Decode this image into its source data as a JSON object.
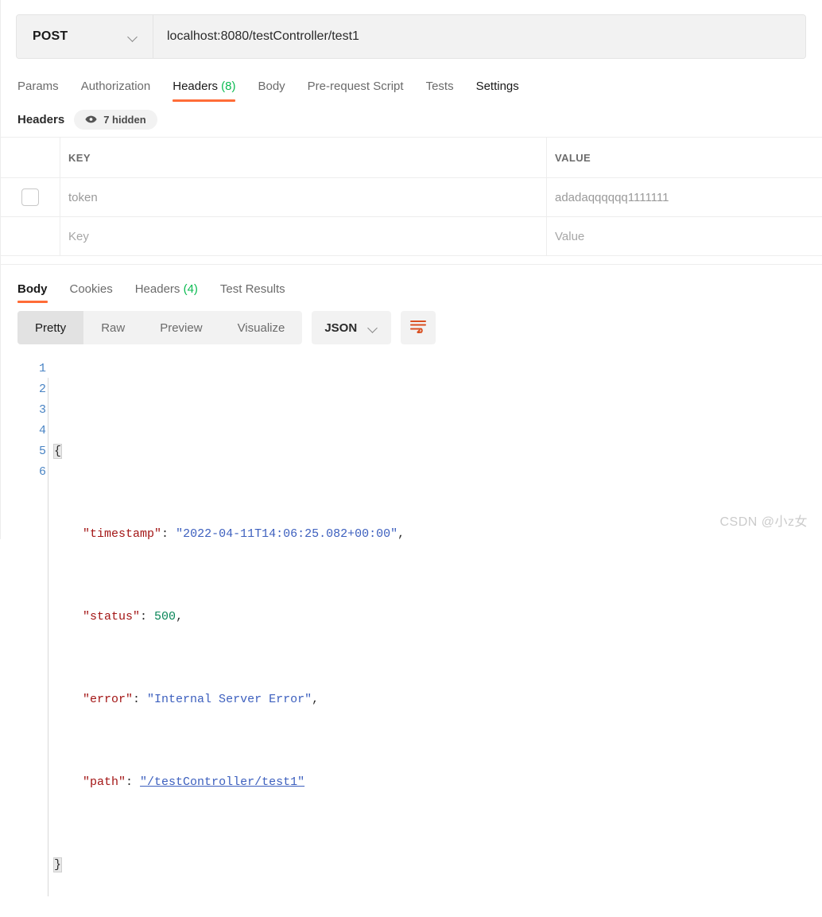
{
  "request": {
    "method": "POST",
    "url": "localhost:8080/testController/test1",
    "method_dropdown_icon": "chevron-down-icon",
    "tabs": [
      {
        "label": "Params",
        "count": "",
        "active": false,
        "bold": false
      },
      {
        "label": "Authorization",
        "count": "",
        "active": false,
        "bold": false
      },
      {
        "label": "Headers",
        "count": "(8)",
        "active": true,
        "bold": false
      },
      {
        "label": "Body",
        "count": "",
        "active": false,
        "bold": false
      },
      {
        "label": "Pre-request Script",
        "count": "",
        "active": false,
        "bold": false
      },
      {
        "label": "Tests",
        "count": "",
        "active": false,
        "bold": false
      },
      {
        "label": "Settings",
        "count": "",
        "active": false,
        "bold": true
      }
    ]
  },
  "headers_section": {
    "title": "Headers",
    "hidden_badge": {
      "icon": "eye-icon",
      "label": "7 hidden"
    },
    "columns": {
      "key": "KEY",
      "value": "VALUE"
    },
    "rows": [
      {
        "checkbox": true,
        "key": "token",
        "value": "adadaqqqqqq1111111",
        "placeholder_row": false
      },
      {
        "checkbox": false,
        "key": "Key",
        "value": "Value",
        "placeholder_row": true
      }
    ]
  },
  "response": {
    "tabs": [
      {
        "label": "Body",
        "count": "",
        "active": true
      },
      {
        "label": "Cookies",
        "count": "",
        "active": false
      },
      {
        "label": "Headers",
        "count": "(4)",
        "active": false
      },
      {
        "label": "Test Results",
        "count": "",
        "active": false
      }
    ],
    "view_modes": [
      {
        "label": "Pretty",
        "active": true
      },
      {
        "label": "Raw",
        "active": false
      },
      {
        "label": "Preview",
        "active": false
      },
      {
        "label": "Visualize",
        "active": false
      }
    ],
    "format": {
      "label": "JSON",
      "icon": "chevron-down-icon"
    },
    "wrap_button": {
      "icon": "wrap-text-icon"
    },
    "body": {
      "line_numbers": [
        "1",
        "2",
        "3",
        "4",
        "5",
        "6"
      ],
      "open_brace": "{",
      "close_brace": "}",
      "entries": [
        {
          "key": "\"timestamp\"",
          "sep": ": ",
          "value": "\"2022-04-11T14:06:25.082+00:00\"",
          "type": "string",
          "comma": ","
        },
        {
          "key": "\"status\"",
          "sep": ": ",
          "value": "500",
          "type": "number",
          "comma": ","
        },
        {
          "key": "\"error\"",
          "sep": ": ",
          "value": "\"Internal Server Error\"",
          "type": "string",
          "comma": ","
        },
        {
          "key": "\"path\"",
          "sep": ": ",
          "value": "\"/testController/test1\"",
          "type": "string-link",
          "comma": ""
        }
      ]
    }
  },
  "watermark": "CSDN @小z女",
  "colors": {
    "accent": "#ff6c37",
    "count_green": "#0cbb52",
    "json_key": "#a31515",
    "json_string": "#3c5fbe",
    "json_number": "#098658",
    "gutter": "#4a84c4"
  }
}
